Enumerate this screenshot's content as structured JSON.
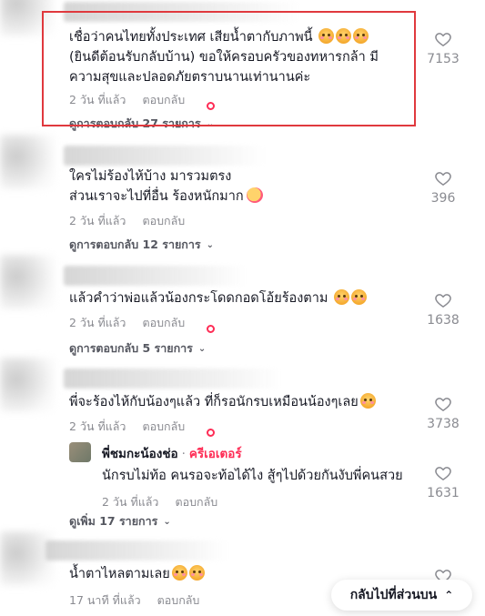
{
  "comments": [
    {
      "text_lines": [
        "เชื่อว่าคนไทยทั้งประเทศ เสียน้ำตากับภาพนี้",
        "(ยินดีต้อนรับกลับบ้าน) ขอให้ครอบครัวของทหารกล้า มี",
        "ความสุขและปลอดภัยตราบนานเท่านานค่ะ"
      ],
      "time": "2 วัน ที่แล้ว",
      "reply_label": "ตอบกลับ",
      "replies_label": "ดูการตอบกลับ 27 รายการ",
      "likes": "7153"
    },
    {
      "text_lines": [
        "ใครไม่ร้องไห้บ้าง มารวมตรง",
        "ส่วนเราจะไปที่อื่น ร้องหนักมาก"
      ],
      "time": "2 วัน ที่แล้ว",
      "reply_label": "ตอบกลับ",
      "replies_label": "ดูการตอบกลับ 12 รายการ",
      "likes": "396"
    },
    {
      "text_lines": [
        "แล้วคำว่าพ่อแล้วน้องกระโดดกอดโอ้ยร้องตาม"
      ],
      "time": "2 วัน ที่แล้ว",
      "reply_label": "ตอบกลับ",
      "replies_label": "ดูการตอบกลับ 5 รายการ",
      "likes": "1638"
    },
    {
      "text_lines": [
        "พี่จะร้องไห้กับน้องๆแล้ว ที่ก็รอนักรบเหมือนน้องๆเลย"
      ],
      "time": "2 วัน ที่แล้ว",
      "reply_label": "ตอบกลับ",
      "likes": "3738",
      "nested_reply": {
        "name": "พี่ชมกะน้องช่อ",
        "separator": "·",
        "badge": "ครีเอเตอร์",
        "text": "นักรบไม่ท้อ คนรอจะท้อได้ไง สู้ๆไปด้วยกันงับพี่คนสวย",
        "time": "2 วัน ที่แล้ว",
        "reply_label": "ตอบกลับ",
        "likes": "1631"
      },
      "more_label": "ดูเพิ่ม 17 รายการ"
    },
    {
      "text_lines": [
        "น้ำตาไหลตามเลย"
      ],
      "time": "17 นาที ที่แล้ว",
      "reply_label": "ตอบกลับ"
    }
  ],
  "back_to_top": "กลับไปที่ส่วนบน",
  "colors": {
    "highlight": "#e0393e",
    "creator": "#fe2c55",
    "muted": "#8a8b91"
  }
}
